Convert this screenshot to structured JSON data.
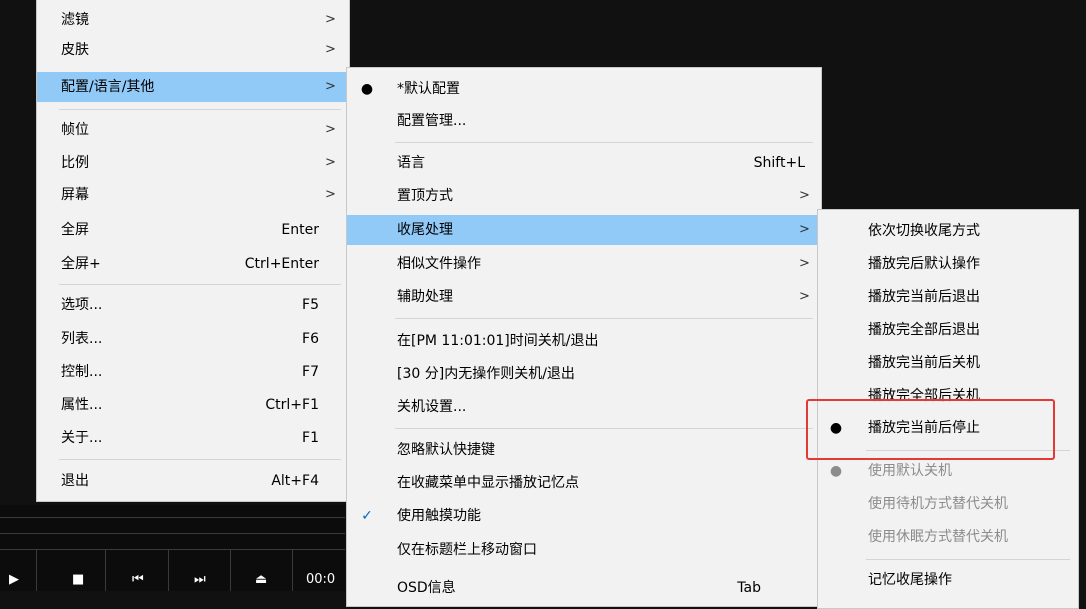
{
  "main_menu": {
    "items": [
      {
        "label": "滤镜",
        "shortcut": "",
        "arrow": true
      },
      {
        "label": "皮肤",
        "shortcut": "",
        "arrow": true
      },
      {
        "label": "配置/语言/其他",
        "shortcut": "",
        "arrow": true
      },
      {
        "label": "帧位",
        "shortcut": "",
        "arrow": true
      },
      {
        "label": "比例",
        "shortcut": "",
        "arrow": true
      },
      {
        "label": "屏幕",
        "shortcut": "",
        "arrow": true
      },
      {
        "label": "全屏",
        "shortcut": "Enter",
        "arrow": false
      },
      {
        "label": "全屏+",
        "shortcut": "Ctrl+Enter",
        "arrow": false
      },
      {
        "label": "选项...",
        "shortcut": "F5",
        "arrow": false
      },
      {
        "label": "列表...",
        "shortcut": "F6",
        "arrow": false
      },
      {
        "label": "控制...",
        "shortcut": "F7",
        "arrow": false
      },
      {
        "label": "属性...",
        "shortcut": "Ctrl+F1",
        "arrow": false
      },
      {
        "label": "关于...",
        "shortcut": "F1",
        "arrow": false
      },
      {
        "label": "退出",
        "shortcut": "Alt+F4",
        "arrow": false
      }
    ],
    "arrow_glyph": ">"
  },
  "config_menu": {
    "items": [
      {
        "label": "*默认配置",
        "mark": "●"
      },
      {
        "label": "配置管理..."
      },
      {
        "label": "语言",
        "shortcut": "Shift+L"
      },
      {
        "label": "置顶方式"
      },
      {
        "label": "收尾处理"
      },
      {
        "label": "相似文件操作"
      },
      {
        "label": "辅助处理"
      },
      {
        "label": "在[PM 11:01:01]时间关机/退出"
      },
      {
        "label": "[30 分]内无操作则关机/退出"
      },
      {
        "label": "关机设置..."
      },
      {
        "label": "忽略默认快捷键"
      },
      {
        "label": "在收藏菜单中显示播放记忆点"
      },
      {
        "label": "使用触摸功能",
        "mark": "✓"
      },
      {
        "label": "仅在标题栏上移动窗口"
      },
      {
        "label": "OSD信息",
        "shortcut": "Tab"
      }
    ]
  },
  "end_menu": {
    "items": [
      {
        "label": "依次切换收尾方式"
      },
      {
        "label": "播放完后默认操作"
      },
      {
        "label": "播放完当前后退出"
      },
      {
        "label": "播放完全部后退出"
      },
      {
        "label": "播放完当前后关机"
      },
      {
        "label": "播放完全部后关机"
      },
      {
        "label": "播放完当前后停止",
        "mark": "●"
      },
      {
        "label": "使用默认关机",
        "mark": "●"
      },
      {
        "label": "使用待机方式替代关机"
      },
      {
        "label": "使用休眠方式替代关机"
      },
      {
        "label": "记忆收尾操作"
      }
    ]
  },
  "player": {
    "time_text": "00:0",
    "buttons": [
      "▶",
      "■",
      "⏮",
      "⏭",
      "⏏"
    ]
  },
  "colors": {
    "highlight": "#91c9f7",
    "annotation_box": "#e53935"
  }
}
